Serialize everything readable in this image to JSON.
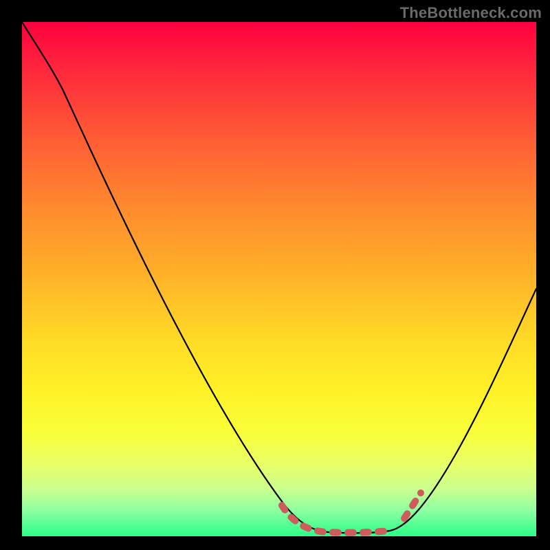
{
  "watermark": "TheBottleneck.com",
  "chart_data": {
    "type": "line",
    "title": "",
    "xlabel": "",
    "ylabel": "",
    "xlim": [
      0,
      100
    ],
    "ylim": [
      0,
      100
    ],
    "series": [
      {
        "name": "bottleneck_curve",
        "x": [
          0,
          5,
          10,
          15,
          20,
          25,
          30,
          35,
          40,
          45,
          50,
          55,
          60,
          65,
          70,
          75,
          80,
          85,
          90,
          95,
          100
        ],
        "values": [
          100,
          96,
          89,
          80,
          70,
          60,
          50,
          40,
          30,
          20,
          12,
          5,
          1,
          0,
          0,
          2,
          8,
          18,
          30,
          43,
          57
        ]
      },
      {
        "name": "optimal_zone",
        "x": [
          55,
          58,
          62,
          66,
          70,
          74,
          78
        ],
        "values": [
          4,
          1,
          0,
          0,
          0,
          1,
          5
        ]
      }
    ],
    "gradient_stops": [
      {
        "offset": 0.0,
        "color": "#ff0040"
      },
      {
        "offset": 0.1,
        "color": "#ff2a3c"
      },
      {
        "offset": 0.22,
        "color": "#ff5a35"
      },
      {
        "offset": 0.36,
        "color": "#ff8a2e"
      },
      {
        "offset": 0.5,
        "color": "#ffb428"
      },
      {
        "offset": 0.62,
        "color": "#ffdb26"
      },
      {
        "offset": 0.72,
        "color": "#fff227"
      },
      {
        "offset": 0.8,
        "color": "#f9ff3a"
      },
      {
        "offset": 0.86,
        "color": "#e9ff68"
      },
      {
        "offset": 0.91,
        "color": "#c8ff90"
      },
      {
        "offset": 0.95,
        "color": "#8dffa0"
      },
      {
        "offset": 1.0,
        "color": "#2aff88"
      }
    ],
    "frame": {
      "left": 32,
      "top": 32,
      "size": 748
    }
  }
}
